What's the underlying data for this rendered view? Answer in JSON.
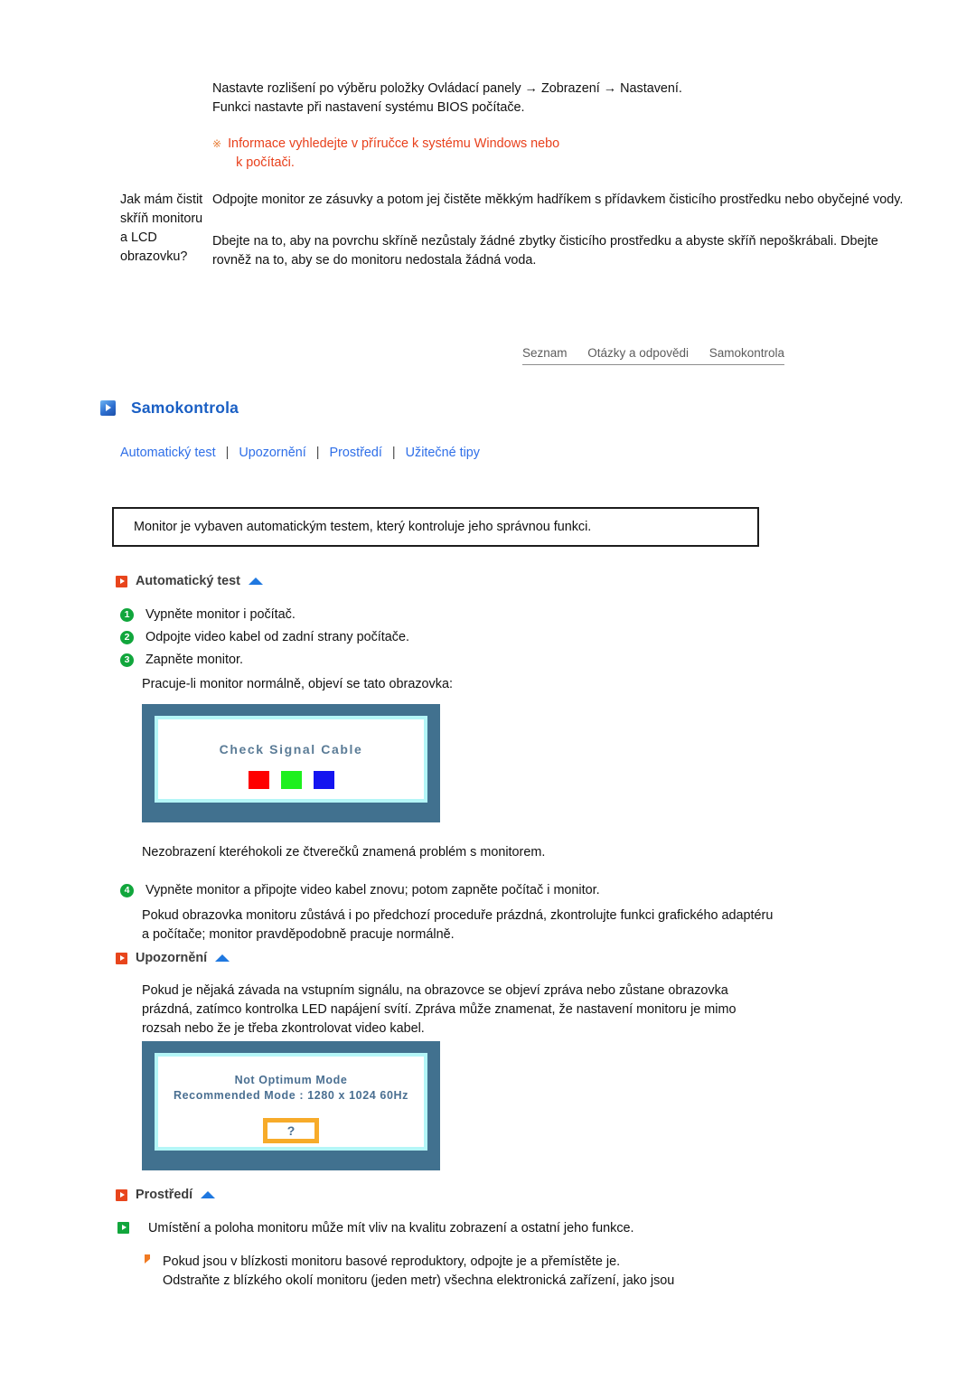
{
  "faq": {
    "entries": [
      {
        "question": "",
        "answers": [
          "Nastavte rozlišení po výběru položky Ovládací panely → Zobrazení → Nastavení.",
          "Funkci nastavte při nastavení systému BIOS počítače."
        ],
        "note_mark": "※",
        "note_line1": "Informace vyhledejte v příručce k systému Windows nebo",
        "note_line2": "k počítači."
      },
      {
        "question": "Jak mám čistit skříň monitoru a LCD obrazovku?",
        "answers": [
          "Odpojte monitor ze zásuvky a potom jej čistěte měkkým hadříkem s přídavkem čisticího prostředku nebo obyčejné vody.",
          "Dbejte na to, aby na povrchu skříně nezůstaly žádné zbytky čisticího prostředku a abyste skříň nepoškrábali. Dbejte rovněž na to, aby se do monitoru nedostala žádná voda."
        ]
      }
    ]
  },
  "breadcrumb": {
    "items": [
      "Seznam",
      "Otázky a odpovědi",
      "Samokontrola"
    ]
  },
  "page": {
    "title": "Samokontrola",
    "title_icon": "play-square-icon"
  },
  "subnav": {
    "separator": "|",
    "links": [
      "Automatický test",
      "Upozornění",
      "Prostředí",
      "Užitečné tipy"
    ]
  },
  "intro": {
    "text": "Monitor je vybaven automatickým testem, který kontroluje jeho správnou funkci."
  },
  "sections": {
    "self_test": {
      "heading": "Automatický test",
      "heading_icon": "red-play-square-icon",
      "up_icon": "up-triangle-icon",
      "steps": [
        {
          "num": "1",
          "text": "Vypněte monitor i počítač."
        },
        {
          "num": "2",
          "text": "Odpojte video kabel od zadní strany počítače."
        },
        {
          "num": "3",
          "text": "Zapněte monitor."
        }
      ],
      "after_steps": "Pracuje-li monitor normálně, objeví se tato obrazovka:",
      "graphic": {
        "name": "check-signal-cable-screen",
        "title": "Check Signal Cable",
        "swatches": [
          "#fe0000",
          "#1ef01e",
          "#1414f0"
        ]
      },
      "after_graphic": "Nezobrazení kteréhokoli ze čtverečků znamená problém s monitorem.",
      "step4": {
        "num": "4",
        "text": "Vypněte monitor a připojte video kabel znovu; potom zapněte počítač i monitor."
      },
      "closing": "Pokud obrazovka monitoru zůstává i po předchozí proceduře prázdná, zkontrolujte funkci grafického adaptéru a počítače; monitor pravděpodobně pracuje normálně."
    },
    "warning": {
      "heading": "Upozornění",
      "heading_icon": "red-play-square-icon",
      "up_icon": "up-triangle-icon",
      "body": "Pokud je nějaká závada na vstupním signálu, na obrazovce se objeví zpráva nebo zůstane obrazovka prázdná, zatímco kontrolka LED napájení svítí. Zpráva může znamenat, že nastavení monitoru je mimo rozsah nebo že je třeba zkontrolovat video kabel.",
      "graphic": {
        "name": "not-optimum-mode-screen",
        "line1": "Not Optimum Mode",
        "line2": "Recommended Mode : 1280 x 1024  60Hz",
        "button_label": "?",
        "button_border_color": "#f7ab2a"
      }
    },
    "environment": {
      "heading": "Prostředí",
      "heading_icon": "red-play-square-icon",
      "up_icon": "up-triangle-icon",
      "bullet_icon": "green-play-square-icon",
      "bullet": "Umístění a poloha monitoru může mít vliv na kvalitu zobrazení a ostatní jeho funkce.",
      "sub_icon": "orange-triangle-bullet-icon",
      "sub_line1": "Pokud jsou v blízkosti monitoru basové reproduktory, odpojte je a přemístěte je.",
      "sub_line2": "Odstraňte z blízkého okolí monitoru (jeden metr) všechna elektronická zařízení, jako jsou"
    }
  }
}
